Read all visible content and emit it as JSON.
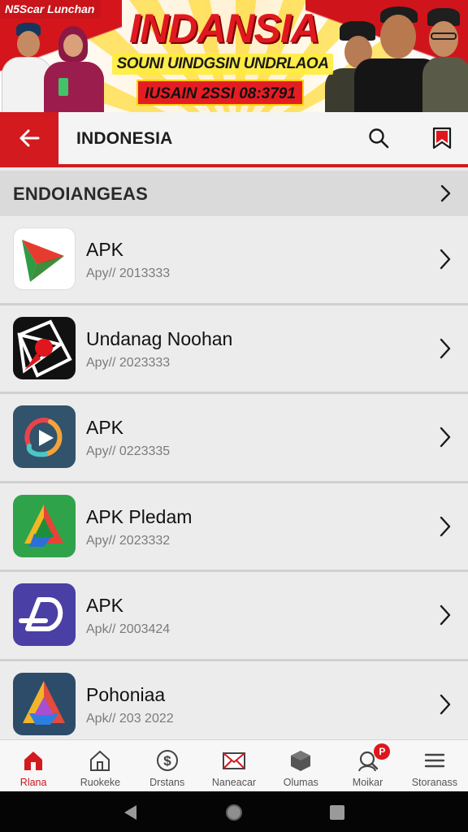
{
  "banner": {
    "corner_label": "N5Scar Lunchan",
    "title": "INDANSIA",
    "subtitle": "SOUNI UINDGSIN UNDRLAOA",
    "date_text": "IUSAIN 2SSI 08:3791"
  },
  "appbar": {
    "title": "INDONESIA",
    "back_icon": "arrow-left-icon",
    "search_icon": "search-icon",
    "bookmark_icon": "bookmark-icon"
  },
  "section": {
    "title": "ENDOIANGEAS"
  },
  "apps": [
    {
      "name": "APK",
      "meta": "Apy// 2013333",
      "icon": "play-arrow-icon"
    },
    {
      "name": "Undanag Noohan",
      "meta": "Apy// 2023333",
      "icon": "star-pointer-icon"
    },
    {
      "name": "APK",
      "meta": "Apy// 0223335",
      "icon": "swirl-play-icon"
    },
    {
      "name": "APK Pledam",
      "meta": "Apy// 2023332",
      "icon": "triangle-drive-icon"
    },
    {
      "name": "APK",
      "meta": "Apk// 2003424",
      "icon": "d-logo-icon"
    },
    {
      "name": "Pohoniaa",
      "meta": "Apk// 203 2022",
      "icon": "gradient-triangle-icon"
    }
  ],
  "bottom_nav": [
    {
      "label": "Rlana",
      "icon": "home-filled-icon",
      "active": true
    },
    {
      "label": "Ruokeke",
      "icon": "home-outline-icon"
    },
    {
      "label": "Drstans",
      "icon": "dollar-circle-icon"
    },
    {
      "label": "Naneacar",
      "icon": "mail-icon"
    },
    {
      "label": "Olumas",
      "icon": "box-icon"
    },
    {
      "label": "Moikar",
      "icon": "search-person-icon",
      "badge": "P"
    },
    {
      "label": "Storanass",
      "icon": "menu-icon"
    }
  ],
  "colors": {
    "accent_red": "#d21a1f",
    "background": "#ececec"
  }
}
